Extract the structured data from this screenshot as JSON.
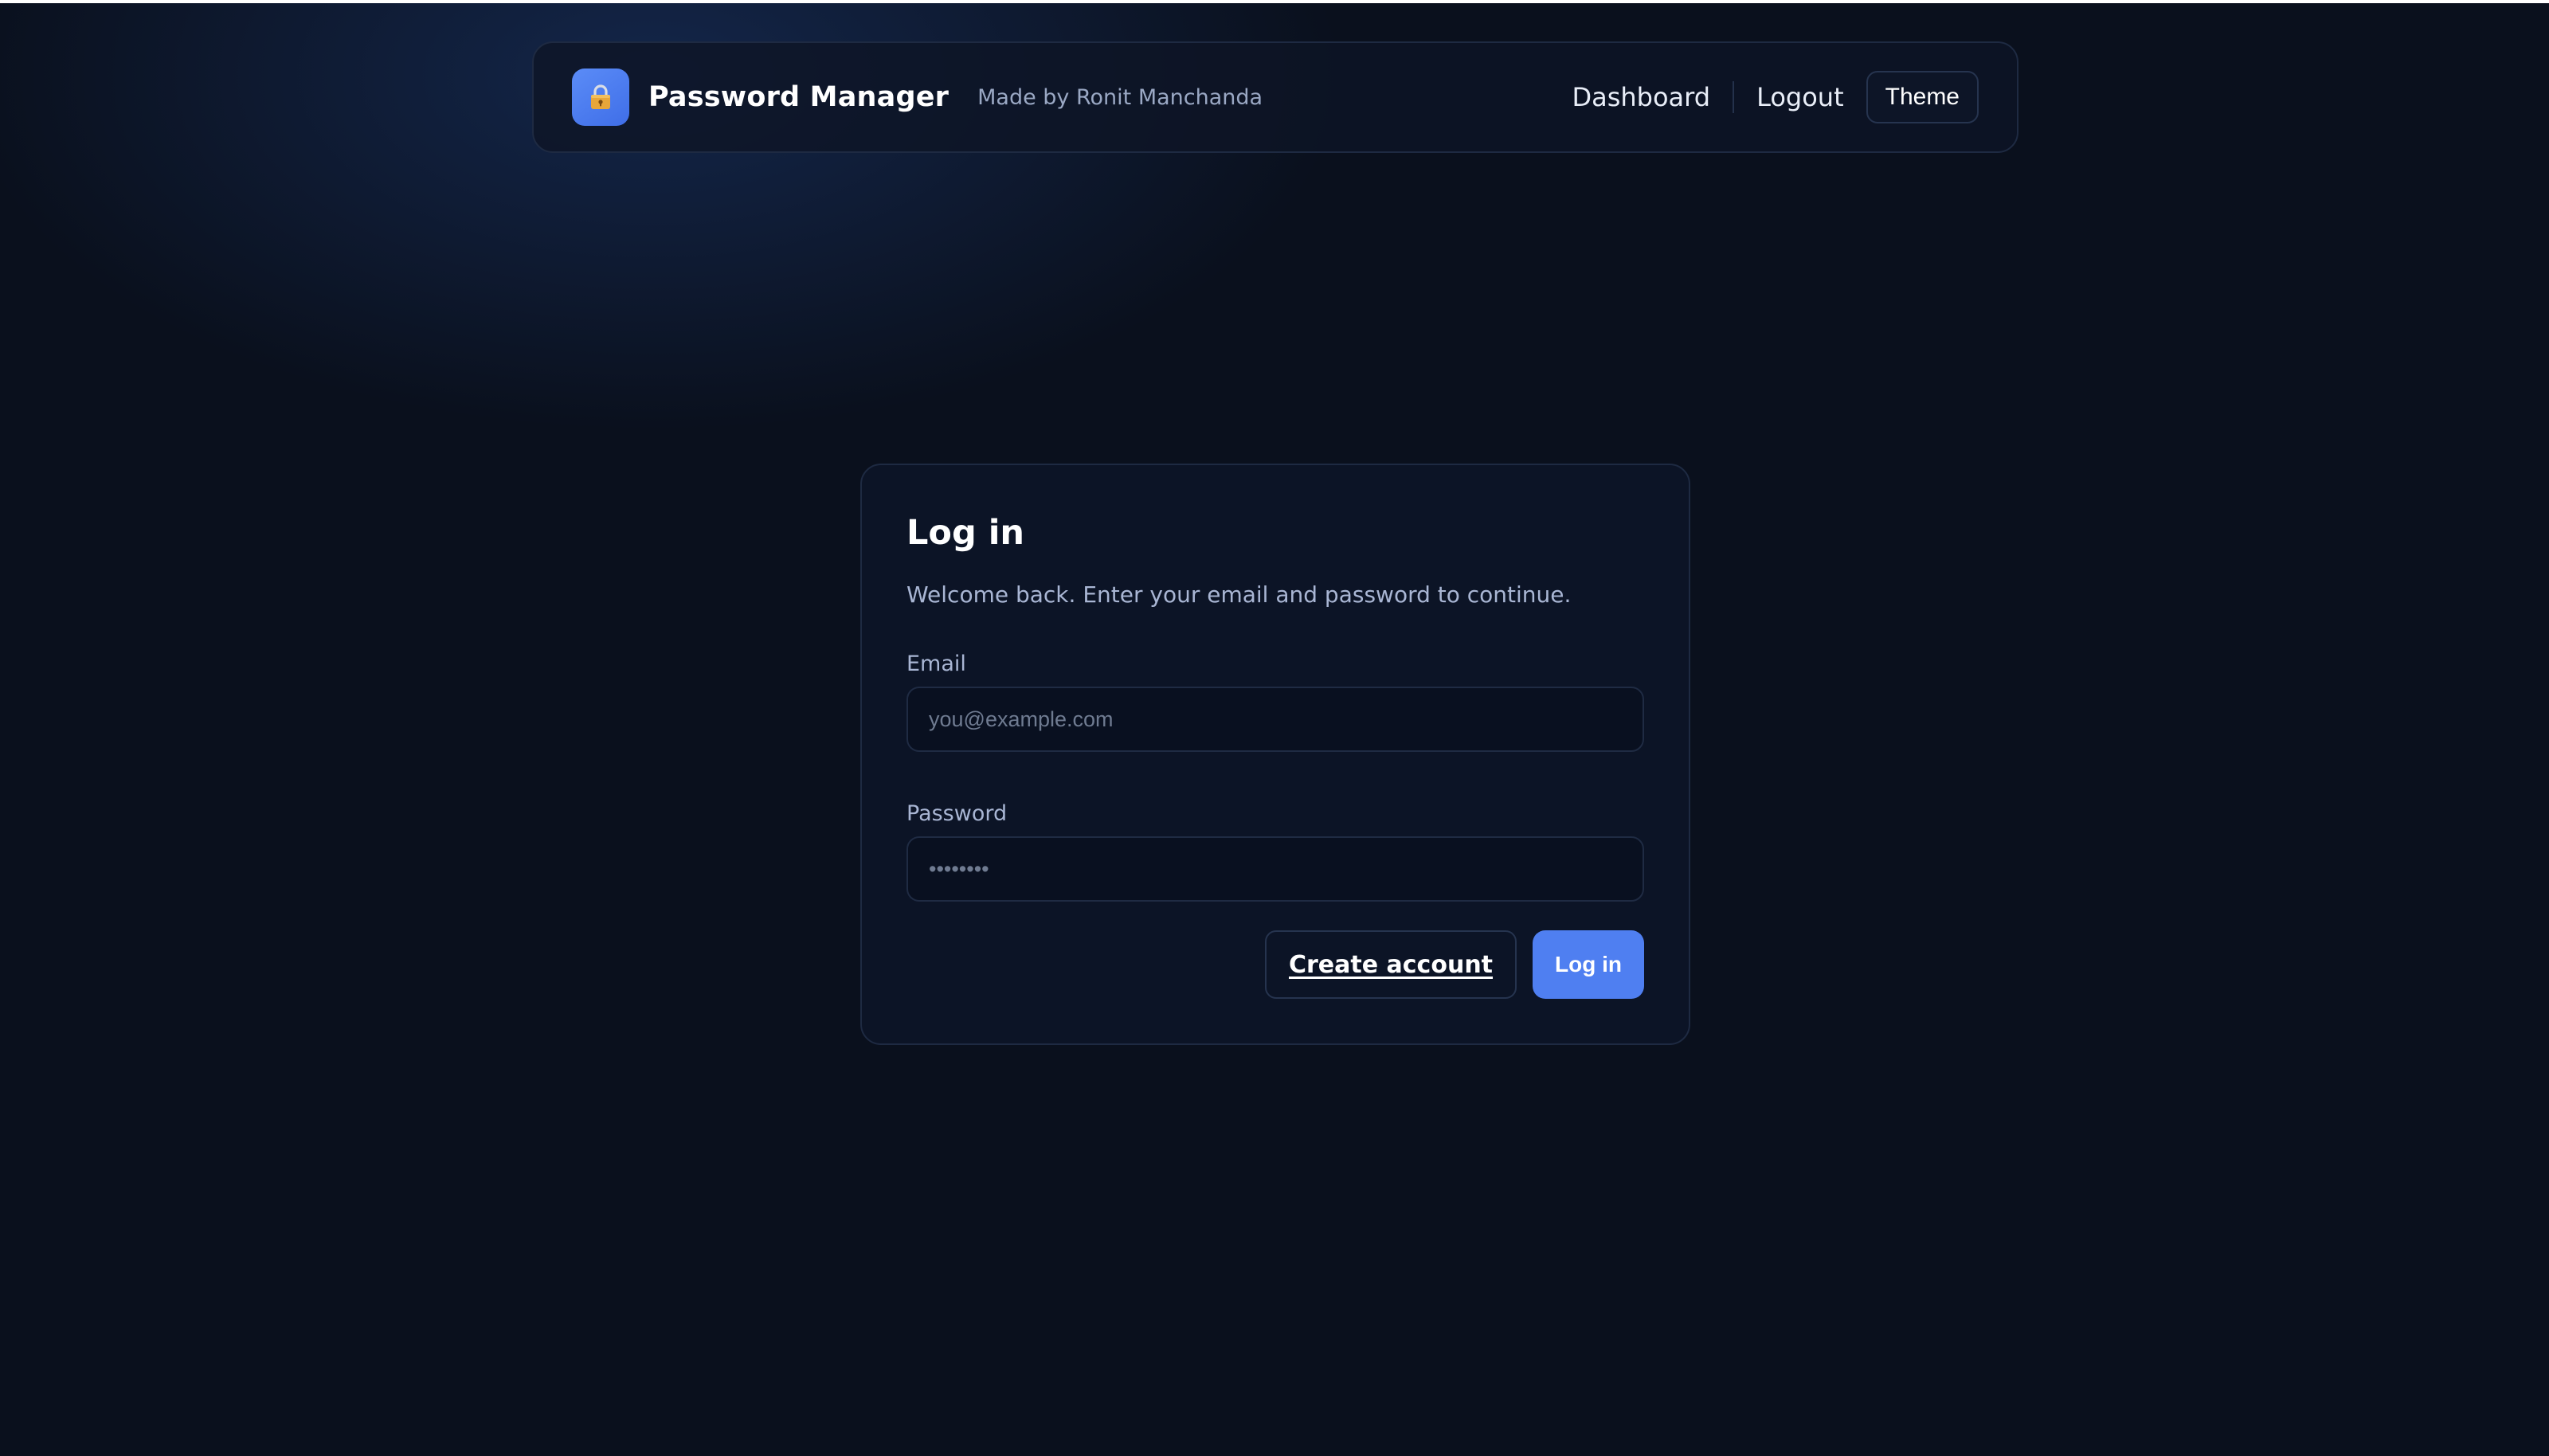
{
  "header": {
    "logo_icon": "lock-icon",
    "title": "Password Manager",
    "credit": "Made by Ronit Manchanda",
    "nav": {
      "dashboard": "Dashboard",
      "logout": "Logout",
      "theme": "Theme"
    }
  },
  "login": {
    "title": "Log in",
    "subtitle": "Welcome back. Enter your email and password to continue.",
    "email": {
      "label": "Email",
      "placeholder": "you@example.com",
      "value": ""
    },
    "password": {
      "label": "Password",
      "placeholder": "••••••••",
      "value": ""
    },
    "create_account_label": "Create account",
    "submit_label": "Log in"
  },
  "colors": {
    "background": "#0a101d",
    "card": "#0c1426",
    "accent": "#4f7ff1",
    "muted_text": "#a9b6d4"
  }
}
